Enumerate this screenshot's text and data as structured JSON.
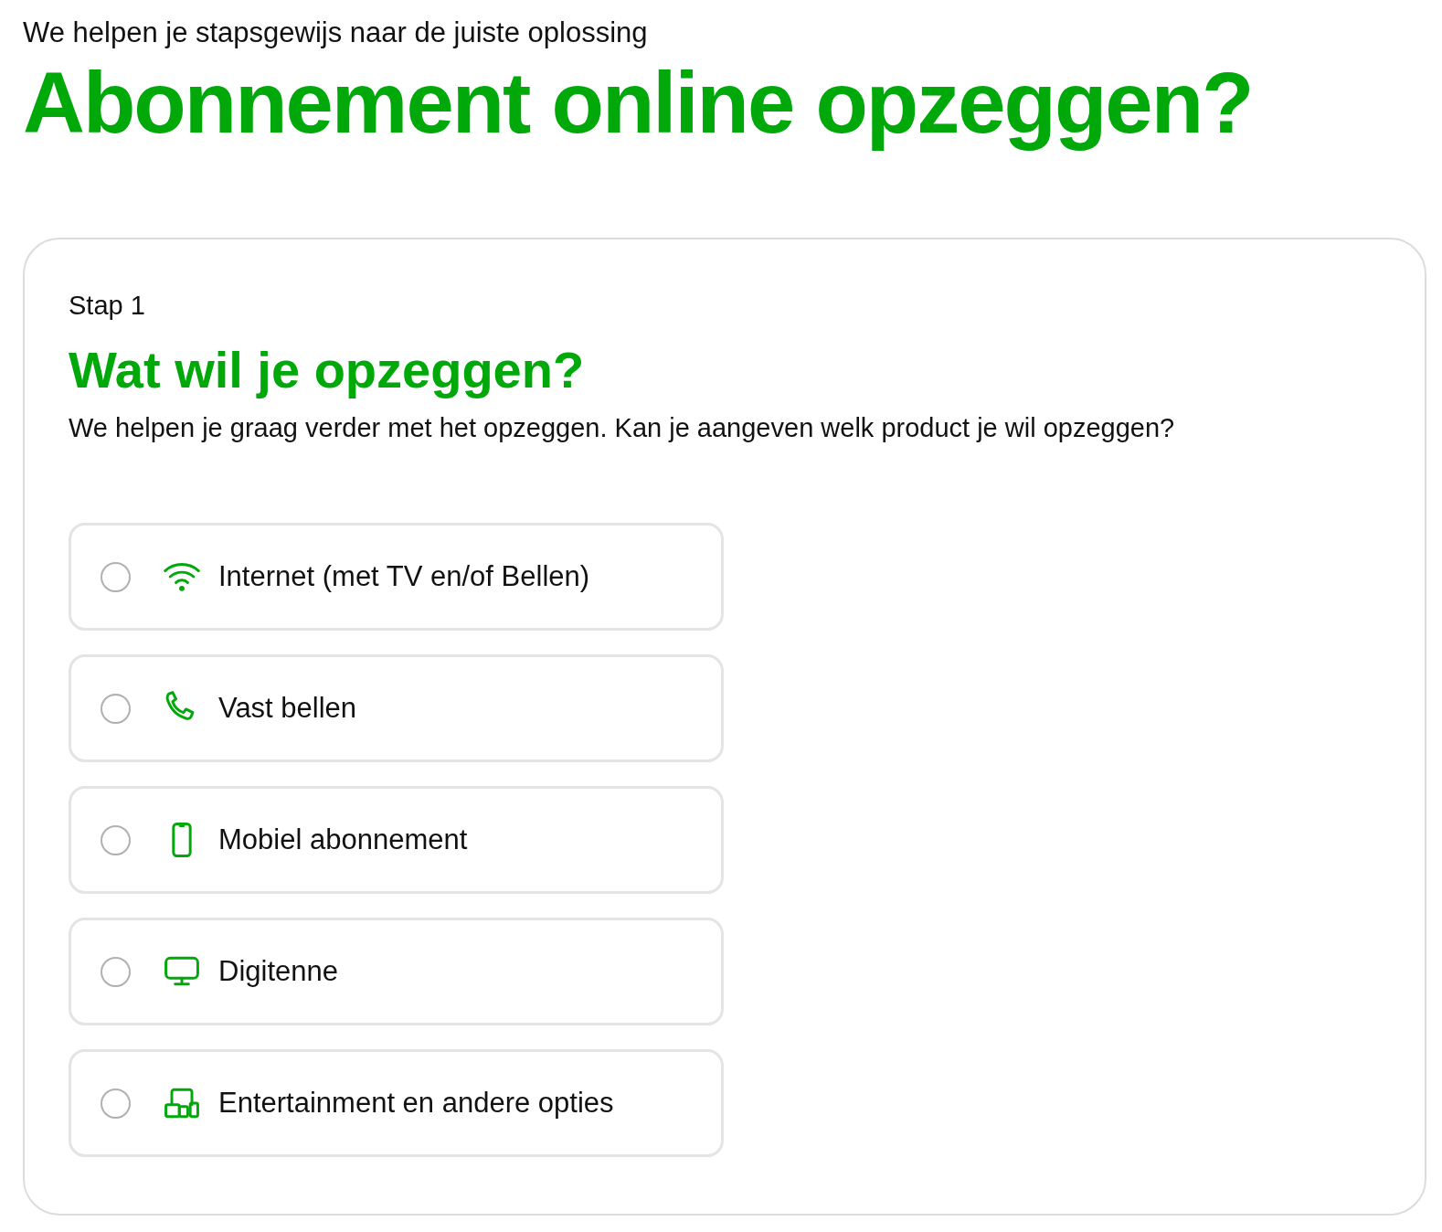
{
  "intro": "We helpen je stapsgewijs naar de juiste oplossing",
  "title": "Abonnement online opzeggen?",
  "step": {
    "label": "Stap 1",
    "heading": "Wat wil je opzeggen?",
    "description": "We helpen je graag verder met het opzeggen. Kan je aangeven welk product je wil opzeggen?",
    "options": [
      {
        "label": "Internet (met TV en/of Bellen)",
        "kind": "wifi",
        "selected": false
      },
      {
        "label": "Vast bellen",
        "kind": "phone",
        "selected": false
      },
      {
        "label": "Mobiel abonnement",
        "kind": "mobile",
        "selected": false
      },
      {
        "label": "Digitenne",
        "kind": "tv",
        "selected": false
      },
      {
        "label": "Entertainment en andere opties",
        "kind": "devices",
        "selected": false
      }
    ]
  }
}
